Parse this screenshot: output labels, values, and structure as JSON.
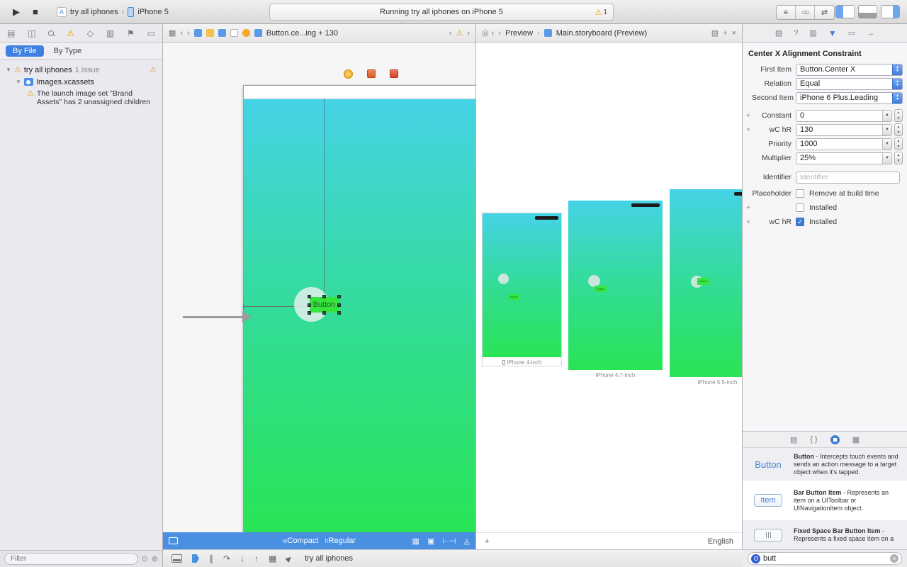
{
  "colors": {
    "accent_blue": "#4a90e2",
    "gradient_top": "#45d3e6",
    "gradient_bottom": "#2ae455",
    "selection_green": "#37e43e",
    "warning_yellow": "#e8a317"
  },
  "toolbar": {
    "scheme": "try all iphones",
    "device": "iPhone 5",
    "status": "Running try all iphones on iPhone 5",
    "warning_count": "1"
  },
  "navigator": {
    "by_file": "By File",
    "by_type": "By Type",
    "project_name": "try all iphones",
    "project_issue_count": "1 issue",
    "asset_name": "Images.xcassets",
    "issue_message": "The launch image set \"Brand Assets\" has 2 unassigned children",
    "filter_placeholder": "Filter"
  },
  "editor": {
    "jump_title": "Button.ce...ing + 130",
    "button_label": "Button",
    "size_w": "w",
    "size_w_value": "Compact",
    "size_h": "h",
    "size_h_value": "Regular"
  },
  "assistant": {
    "mode": "Preview",
    "file": "Main.storyboard (Preview)",
    "previews": [
      {
        "label": "iPhone 4-inch",
        "button": "Button"
      },
      {
        "label": "iPhone 4.7-inch",
        "button": "Button"
      },
      {
        "label": "iPhone 5.5-inch",
        "button": "Button"
      }
    ],
    "add": "+",
    "language": "English"
  },
  "inspector": {
    "title": "Center X Alignment Constraint",
    "first_item_label": "First Item",
    "first_item_value": "Button.Center X",
    "relation_label": "Relation",
    "relation_value": "Equal",
    "second_item_label": "Second Item",
    "second_item_value": "iPhone 6 Plus.Leading",
    "constant_label": "Constant",
    "constant_value": "0",
    "variant_label": "wC hR",
    "variant_value": "130",
    "priority_label": "Priority",
    "priority_value": "1000",
    "multiplier_label": "Multiplier",
    "multiplier_value": "25%",
    "identifier_label": "Identifier",
    "identifier_placeholder": "Identifier",
    "placeholder_label": "Placeholder",
    "placeholder_checkbox": "Remove at build time",
    "installed_label": "Installed",
    "installed_variant_prefix": "wC hR",
    "installed_variant_label": "Installed"
  },
  "library": {
    "items": [
      {
        "badge": "Button",
        "name": "Button",
        "desc": "- Intercepts touch events and sends an action message to a target object when it's tapped."
      },
      {
        "badge": "Item",
        "name": "Bar Button Item",
        "desc": "- Represents an item on a UIToolbar or UINavigationItem object."
      },
      {
        "badge": "",
        "name": "Fixed Space Bar Button Item",
        "desc": "- Represents a fixed space item on a"
      }
    ],
    "search_value": "butt"
  },
  "debug": {
    "scheme": "try all iphones"
  }
}
